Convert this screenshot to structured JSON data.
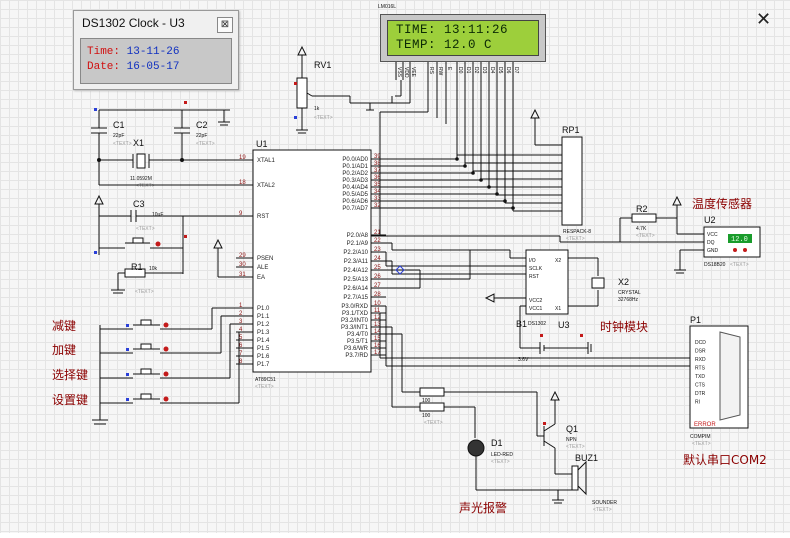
{
  "popup": {
    "title": "DS1302 Clock - U3",
    "close_label": "⊠",
    "time_label": "Time:",
    "time_value": "13-11-26",
    "date_label": "Date:",
    "date_value": "16-05-17"
  },
  "window_close": "✕",
  "lcd": {
    "ref": "LM016L",
    "line1": "TIME: 13:11:26",
    "line2": "TEMP:   12.0  C",
    "pins": [
      "VSS",
      "VDD",
      "VEE",
      "RS",
      "RW",
      "E",
      "D0",
      "D1",
      "D2",
      "D3",
      "D4",
      "D5",
      "D6",
      "D7"
    ]
  },
  "rv1": {
    "ref": "RV1",
    "value": "1k"
  },
  "c1": {
    "ref": "C1",
    "value": "22pF"
  },
  "c2": {
    "ref": "C2",
    "value": "22pF"
  },
  "c3": {
    "ref": "C3",
    "value": "10uF"
  },
  "x1": {
    "ref": "X1",
    "value": "11.0592M"
  },
  "r1": {
    "ref": "R1",
    "value": "10k"
  },
  "u1": {
    "ref": "U1",
    "part": "AT89C51",
    "left_pins": [
      {
        "name": "XTAL1",
        "num": "19"
      },
      {
        "name": "XTAL2",
        "num": "18"
      },
      {
        "name": "RST",
        "num": "9"
      },
      {
        "name": "PSEN",
        "num": "29"
      },
      {
        "name": "ALE",
        "num": "30"
      },
      {
        "name": "EA",
        "num": "31"
      },
      {
        "name": "P1.0",
        "num": "1"
      },
      {
        "name": "P1.1",
        "num": "2"
      },
      {
        "name": "P1.2",
        "num": "3"
      },
      {
        "name": "P1.3",
        "num": "4"
      },
      {
        "name": "P1.4",
        "num": "5"
      },
      {
        "name": "P1.5",
        "num": "6"
      },
      {
        "name": "P1.6",
        "num": "7"
      },
      {
        "name": "P1.7",
        "num": "8"
      }
    ],
    "right_pins": [
      {
        "name": "P0.0/AD0",
        "num": "39"
      },
      {
        "name": "P0.1/AD1",
        "num": "38"
      },
      {
        "name": "P0.2/AD2",
        "num": "37"
      },
      {
        "name": "P0.3/AD3",
        "num": "36"
      },
      {
        "name": "P0.4/AD4",
        "num": "35"
      },
      {
        "name": "P0.5/AD5",
        "num": "34"
      },
      {
        "name": "P0.6/AD6",
        "num": "33"
      },
      {
        "name": "P0.7/AD7",
        "num": "32"
      },
      {
        "name": "P2.0/A8",
        "num": "21"
      },
      {
        "name": "P2.1/A9",
        "num": "22"
      },
      {
        "name": "P2.2/A10",
        "num": "23"
      },
      {
        "name": "P2.3/A11",
        "num": "24"
      },
      {
        "name": "P2.4/A12",
        "num": "25"
      },
      {
        "name": "P2.5/A13",
        "num": "26"
      },
      {
        "name": "P2.6/A14",
        "num": "27"
      },
      {
        "name": "P2.7/A15",
        "num": "28"
      },
      {
        "name": "P3.0/RXD",
        "num": "10"
      },
      {
        "name": "P3.1/TXD",
        "num": "11"
      },
      {
        "name": "P3.2/INT0",
        "num": "12"
      },
      {
        "name": "P3.3/INT1",
        "num": "13"
      },
      {
        "name": "P3.4/T0",
        "num": "14"
      },
      {
        "name": "P3.5/T1",
        "num": "15"
      },
      {
        "name": "P3.6/WR",
        "num": "16"
      },
      {
        "name": "P3.7/RD",
        "num": "17"
      }
    ]
  },
  "rp1": {
    "ref": "RP1",
    "part": "RESPACK-8"
  },
  "r2": {
    "ref": "R2",
    "value": "4.7K"
  },
  "u2": {
    "ref": "U2",
    "part": "DS18B20",
    "display": "12.0",
    "pins": [
      "VCC",
      "DQ",
      "GND"
    ],
    "label_cn": "温度传感器"
  },
  "u3": {
    "ref": "U3",
    "part": "DS1302",
    "pins_left": [
      "I/O",
      "SCLK",
      "RST",
      "VCC2",
      "VCC1"
    ],
    "pins_right": [
      "X2",
      "X1"
    ],
    "label_cn": "时钟模块"
  },
  "x2": {
    "ref": "X2",
    "part": "CRYSTAL",
    "value": "32768Hz"
  },
  "b1": {
    "ref": "B1",
    "value": "3.6V"
  },
  "p1": {
    "ref": "P1",
    "part": "COMPIM",
    "pins": [
      "DCD",
      "DSR",
      "RXD",
      "RTS",
      "TXD",
      "CTS",
      "DTR",
      "RI"
    ],
    "error": "ERROR",
    "label_cn": "默认串口COM2"
  },
  "q1": {
    "ref": "Q1",
    "part": "NPN"
  },
  "d1": {
    "ref": "D1",
    "part": "LED-RED"
  },
  "buz1": {
    "ref": "BUZ1",
    "part": "SOUNDER"
  },
  "r100a": {
    "value": "100"
  },
  "r100b": {
    "value": "100"
  },
  "buttons": [
    "减键",
    "加键",
    "选择键",
    "设置键"
  ],
  "alarm_label": "声光报警",
  "text_tag": "<TEXT>"
}
